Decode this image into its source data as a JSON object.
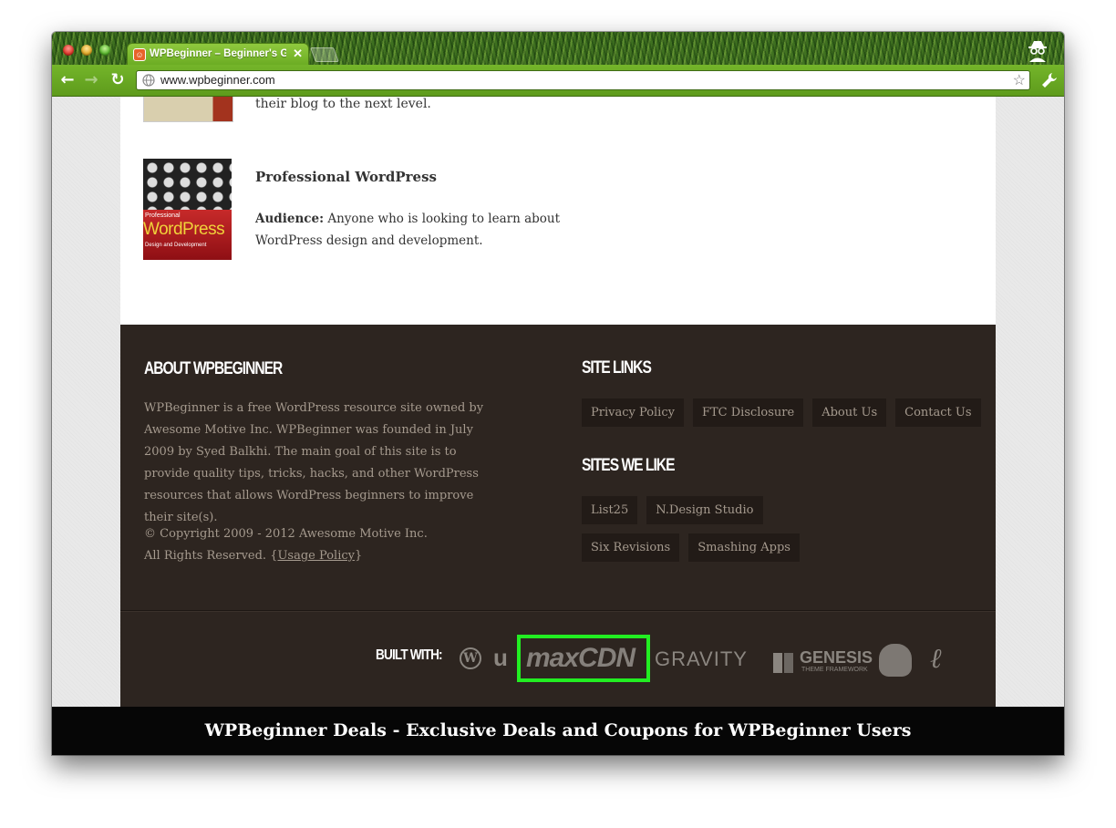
{
  "browser": {
    "tab_title": "WPBeginner – Beginner's Gui",
    "url": "www.wpbeginner.com"
  },
  "content": {
    "prev_book_text": "their blog to the next level.",
    "book": {
      "title": "Professional WordPress",
      "cover_small": "Professional",
      "cover_title": "WordPress",
      "cover_sub": "Design and Development",
      "audience_label": "Audience:",
      "audience_text": " Anyone who is looking to learn about WordPress design and development."
    }
  },
  "footer": {
    "about_heading": "ABOUT WPBEGINNER",
    "about_text": "WPBeginner is a free WordPress resource site owned by Awesome Motive Inc. WPBeginner was founded in July 2009 by Syed Balkhi. The main goal of this site is to provide quality tips, tricks, hacks, and other WordPress resources that allows WordPress beginners to improve their site(s).",
    "copyright_line": "© Copyright 2009 - 2012 Awesome Motive Inc.",
    "rights_text": "All Rights Reserved. {",
    "usage_policy": "Usage Policy",
    "rights_close": "}",
    "site_links_heading": "SITE LINKS",
    "site_links": [
      "Privacy Policy",
      "FTC Disclosure",
      "About Us",
      "Contact Us"
    ],
    "sites_we_like_heading": "SITES WE LIKE",
    "sites_we_like": [
      "List25",
      "N.Design Studio",
      "Six Revisions",
      "Smashing Apps"
    ],
    "built_with_label": "BUILT WITH:",
    "logos": {
      "wp": "W",
      "u": "u",
      "maxcdn": "maxCDN",
      "gravity": "GRAVITY",
      "genesis": "GENESIS",
      "genesis_sub": "THEME FRAMEWORK",
      "script": "ℓ"
    },
    "highlight_color": "#22ee22"
  },
  "deals_bar": {
    "text": "WPBeginner Deals - Exclusive Deals and Coupons for WPBeginner Users"
  }
}
